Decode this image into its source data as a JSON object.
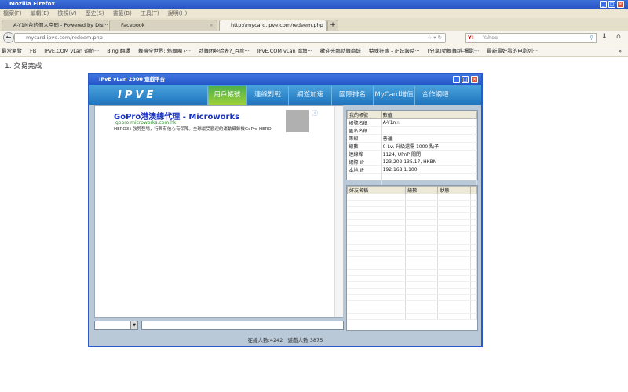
{
  "browser": {
    "title": "Mozilla Firefox",
    "menu": [
      "檔案(F)",
      "編輯(E)",
      "檢視(V)",
      "歷史(S)",
      "書籤(B)",
      "工具(T)",
      "說明(H)"
    ],
    "tabs": [
      {
        "label": "A-Y1N台的個人空間 - Powered by Dis···"
      },
      {
        "label": "Facebook"
      },
      {
        "label": "http://mycard.ipve.com/redeem.php"
      }
    ],
    "new_tab": "+",
    "url": "mycard.ipve.com/redeem.php",
    "search_placeholder": "Yahoo",
    "bookmarks": [
      "最常瀏覽",
      "FB",
      "IPvE.COM vLan 遊戲···",
      "Bing 翻譯",
      "舞遍全世界: 熱舞團 ›···",
      "劲舞团经验表?_百度···",
      "IPvE.COM vLan 論壇···",
      "歡迎光臨勁舞商城",
      "特殊符號 - 正妹報時···",
      "[分享]勁舞舞蹈-攝影···",
      "最新最好看的电影列···"
    ],
    "bookmarks_more": "»"
  },
  "page": {
    "message": "1. 交易完成"
  },
  "app": {
    "title": "IPvE vLan 2900 遊戲平台",
    "logo": "IPVE",
    "nav": [
      "用戶帳號",
      "連線對戰",
      "網遊加速",
      "國際排名",
      "MyCard增值",
      "合作網吧"
    ],
    "ad": {
      "title": "GoPro港澳總代理 - Microworks",
      "url": "gopro.microworks.com.hk",
      "desc": "HERO3+強勢登場，行貨有信心有保障。全球最受歡迎的運動攝錄機GoPro HERO"
    },
    "account": {
      "headers": [
        "我的帳號",
        "數值"
      ],
      "rows": [
        [
          "帳號名稱",
          "A-Y1n☆"
        ],
        [
          "匿名名稱",
          ""
        ],
        [
          "等級",
          "普通"
        ],
        [
          "級數",
          "0 Lv, 升級還需 1000 點子"
        ],
        [
          "連線埠",
          "1124, UPnP 關閉"
        ],
        [
          "網際 IP",
          "123.202.135.17, HKBN"
        ],
        [
          "本地 IP",
          "192.168.1.100"
        ]
      ]
    },
    "friends": {
      "headers": [
        "好友名稱",
        "級數",
        "狀態"
      ]
    },
    "status": {
      "online": "在線人數:4242",
      "playing": "遊戲人數:3875"
    }
  }
}
